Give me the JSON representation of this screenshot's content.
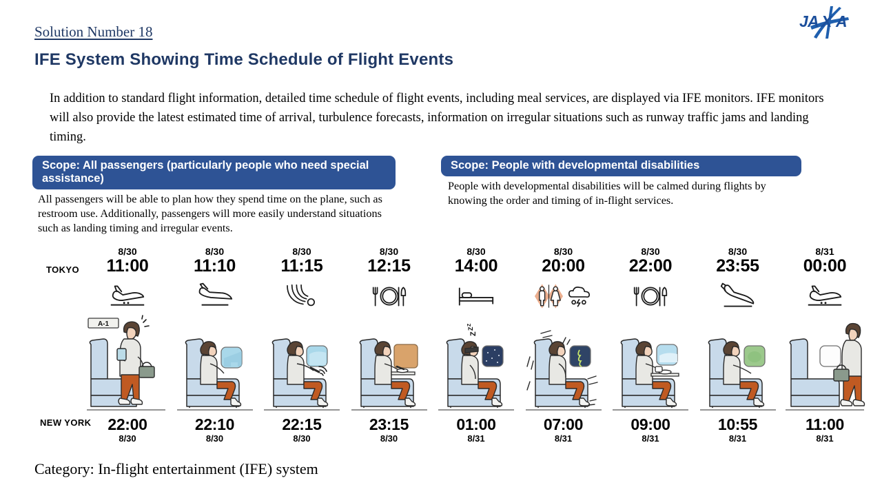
{
  "header": {
    "solution_number": "Solution Number 18",
    "title": "IFE System Showing Time Schedule of Flight Events",
    "logo_text": "JAXA",
    "title_color": "#1F3864"
  },
  "intro": {
    "text": "In addition to standard flight information, detailed time schedule of flight events, including meal services, are displayed via IFE monitors. IFE monitors will also provide the latest estimated time of arrival, turbulence forecasts, information on irregular situations such as runway traffic jams and landing timing."
  },
  "scopes": [
    {
      "banner": "Scope: All passengers (particularly people who need special assistance)",
      "body": "All passengers will be able to plan how they spend time on the plane, such as restroom use. Additionally, passengers will more easily understand situations such as landing timing and irregular events.",
      "banner_color": "#2E5395"
    },
    {
      "banner": "Scope: People with developmental disabilities",
      "body": "People with developmental disabilities will be calmed during flights by knowing the order and timing of in-flight services.",
      "banner_color": "#2E5395"
    }
  ],
  "timeline": {
    "origin_label": "TOKYO",
    "destination_label": "NEW YORK",
    "seat_sign": "A-1",
    "sleep_text": "Z Z Z",
    "columns": [
      {
        "tokyo_date": "8/30",
        "tokyo_time": "11:00",
        "newyork_time": "22:00",
        "newyork_date": "8/30",
        "icon": "plane-boarding-icon",
        "scene": "passenger-boarding-scene"
      },
      {
        "tokyo_date": "8/30",
        "tokyo_time": "11:10",
        "newyork_time": "22:10",
        "newyork_date": "8/30",
        "icon": "plane-takeoff-icon",
        "scene": "passenger-seated-window-scene"
      },
      {
        "tokyo_date": "8/30",
        "tokyo_time": "11:15",
        "newyork_time": "22:15",
        "newyork_date": "8/30",
        "icon": "wifi-icon",
        "scene": "passenger-wifi-scene"
      },
      {
        "tokyo_date": "8/30",
        "tokyo_time": "12:15",
        "newyork_time": "23:15",
        "newyork_date": "8/30",
        "icon": "meal-icon",
        "scene": "passenger-meal-scene"
      },
      {
        "tokyo_date": "8/30",
        "tokyo_time": "14:00",
        "newyork_time": "01:00",
        "newyork_date": "8/31",
        "icon": "bed-icon",
        "scene": "passenger-sleeping-scene"
      },
      {
        "tokyo_date": "8/30",
        "tokyo_time": "20:00",
        "newyork_time": "07:00",
        "newyork_date": "8/31",
        "icon": "restroom-weather-icon",
        "scene": "passenger-turbulence-scene"
      },
      {
        "tokyo_date": "8/30",
        "tokyo_time": "22:00",
        "newyork_time": "09:00",
        "newyork_date": "8/31",
        "icon": "meal-icon",
        "scene": "passenger-meal2-scene"
      },
      {
        "tokyo_date": "8/30",
        "tokyo_time": "23:55",
        "newyork_time": "10:55",
        "newyork_date": "8/31",
        "icon": "plane-landing-icon",
        "scene": "passenger-landing-scene"
      },
      {
        "tokyo_date": "8/31",
        "tokyo_time": "00:00",
        "newyork_time": "11:00",
        "newyork_date": "8/31",
        "icon": "plane-arrived-icon",
        "scene": "passenger-deboarding-scene"
      }
    ]
  },
  "footer": {
    "category": "Category: In-flight entertainment (IFE) system"
  }
}
